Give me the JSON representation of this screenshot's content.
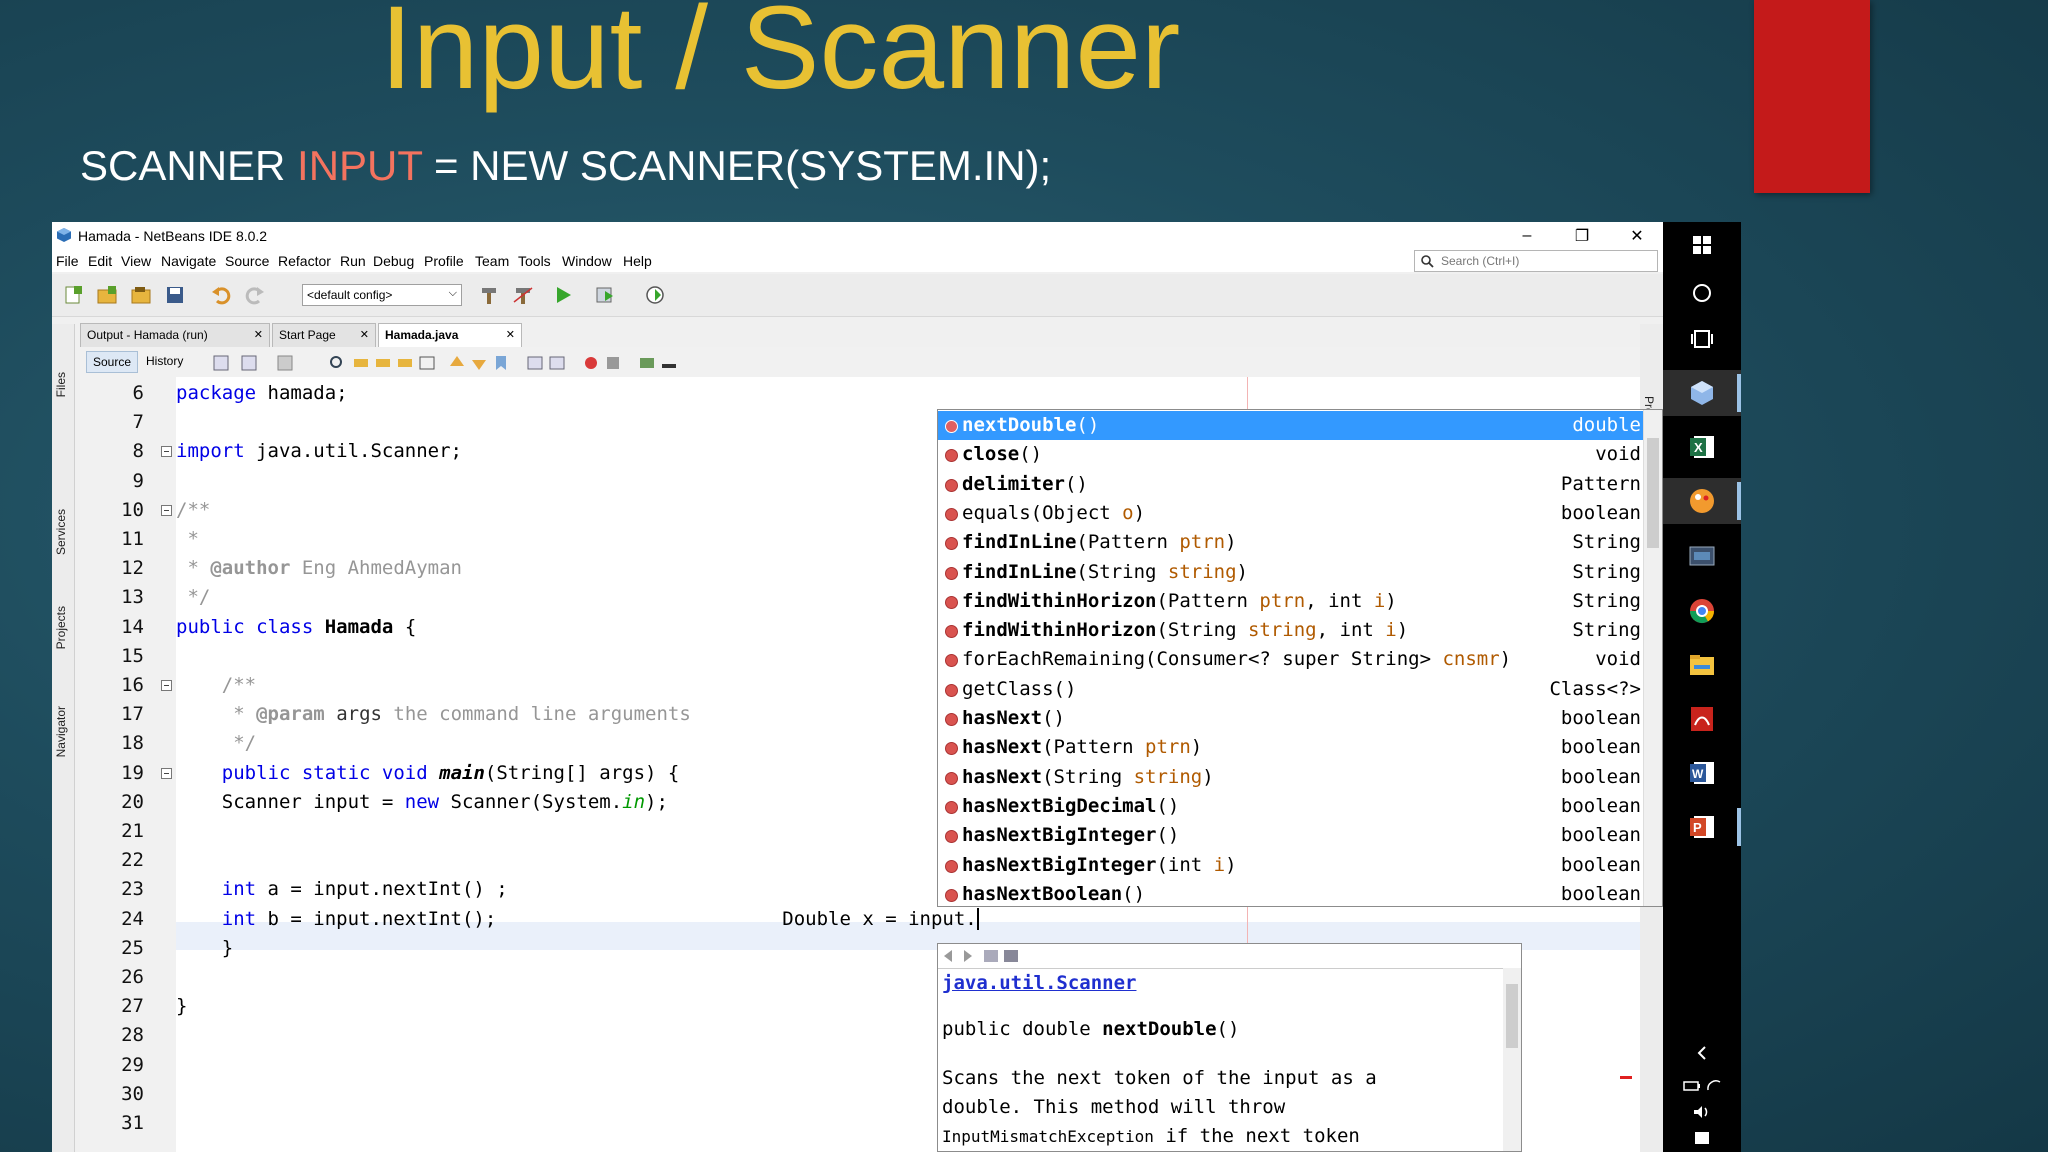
{
  "slide": {
    "title": "Input / Scanner",
    "subtitle_before": "SCANNER ",
    "subtitle_highlight": "INPUT",
    "subtitle_after": " = NEW SCANNER(SYSTEM.IN);",
    "title_color": "#e8c133",
    "highlight_color": "#f4735f",
    "accent_block_color": "#c41a1a"
  },
  "window": {
    "title": "Hamada - NetBeans IDE 8.0.2",
    "controls": {
      "minimize": "–",
      "restore": "❐",
      "close": "✕"
    }
  },
  "menubar": {
    "items": [
      "File",
      "Edit",
      "View",
      "Navigate",
      "Source",
      "Refactor",
      "Run",
      "Debug",
      "Profile",
      "Team",
      "Tools",
      "Window",
      "Help"
    ]
  },
  "search": {
    "placeholder": "Search (Ctrl+I)"
  },
  "toolbar": {
    "config_value": "<default config>"
  },
  "side_panels": [
    "Files",
    "Services",
    "Projects",
    "Navigator"
  ],
  "right_panel": "Prope",
  "tabs": [
    {
      "label": "Output - Hamada (run)"
    },
    {
      "label": "Start Page"
    },
    {
      "label": "Hamada.java",
      "active": true
    }
  ],
  "editor_toolbar": {
    "source_label": "Source",
    "history_label": "History"
  },
  "code": [
    {
      "line": "6",
      "html": "<span class='kw'>package</span> hamada;"
    },
    {
      "line": "7",
      "html": ""
    },
    {
      "line": "8",
      "html": "<span class='kw'>import</span> java.util.Scanner;",
      "fold": true
    },
    {
      "line": "9",
      "html": ""
    },
    {
      "line": "10",
      "html": "<span class='cm'>/**</span>",
      "fold": true
    },
    {
      "line": "11",
      "html": "<span class='cm'> *</span>"
    },
    {
      "line": "12",
      "html": "<span class='cm'> * <span class='tag'>@author</span> Eng AhmedAyman</span>"
    },
    {
      "line": "13",
      "html": "<span class='cm'> */</span>"
    },
    {
      "line": "14",
      "html": "<span class='kw'>public class</span> <span class='bold'>Hamada</span> {"
    },
    {
      "line": "15",
      "html": ""
    },
    {
      "line": "16",
      "html": "    <span class='cm'>/**</span>",
      "fold": true
    },
    {
      "line": "17",
      "html": "    <span class='cm'> * <span class='tag'>@param</span> <span style='color:#333'>args</span> the command line arguments</span>"
    },
    {
      "line": "18",
      "html": "    <span class='cm'> */</span>"
    },
    {
      "line": "19",
      "html": "    <span class='kw'>public static void</span> <span class='bold it'>main</span>(String[] args) {",
      "fold": true
    },
    {
      "line": "20",
      "html": "    Scanner input = <span class='kw'>new</span> Scanner(System.<span class='field'>in</span>);"
    },
    {
      "line": "21",
      "html": ""
    },
    {
      "line": "22",
      "html": ""
    },
    {
      "line": "23",
      "html": "    <span class='kw'>int</span> a = input.nextInt() ;"
    },
    {
      "line": "24",
      "html": "    <span class='kw'>int</span> b = input.nextInt();                         Double x = input.<span class='caret'></span>"
    },
    {
      "line": "25",
      "html": "    }"
    },
    {
      "line": "26",
      "html": ""
    },
    {
      "line": "27",
      "html": "}"
    },
    {
      "line": "28",
      "html": ""
    },
    {
      "line": "29",
      "html": ""
    },
    {
      "line": "30",
      "html": ""
    },
    {
      "line": "31",
      "html": ""
    }
  ],
  "completion": [
    {
      "name": "nextDouble",
      "params": "()",
      "type": "double",
      "bold": true,
      "selected": true
    },
    {
      "name": "close",
      "params": "()",
      "type": "void",
      "bold": true
    },
    {
      "name": "delimiter",
      "params": "()",
      "type": "Pattern",
      "bold": true
    },
    {
      "name": "equals",
      "params": "(Object <span class='pa'>o</span>)",
      "type": "boolean",
      "bold": false
    },
    {
      "name": "findInLine",
      "params": "(Pattern <span class='pa'>ptrn</span>)",
      "type": "String",
      "bold": true
    },
    {
      "name": "findInLine",
      "params": "(String <span class='pa'>string</span>)",
      "type": "String",
      "bold": true
    },
    {
      "name": "findWithinHorizon",
      "params": "(Pattern <span class='pa'>ptrn</span>, int <span class='pa'>i</span>)",
      "type": "String",
      "bold": true
    },
    {
      "name": "findWithinHorizon",
      "params": "(String <span class='pa'>string</span>, int <span class='pa'>i</span>)",
      "type": "String",
      "bold": true
    },
    {
      "name": "forEachRemaining",
      "params": "(Consumer&lt;? super String&gt; <span class='pa'>cnsmr</span>)",
      "type": "void",
      "bold": false
    },
    {
      "name": "getClass",
      "params": "()",
      "type": "Class<?>",
      "bold": false
    },
    {
      "name": "hasNext",
      "params": "()",
      "type": "boolean",
      "bold": true
    },
    {
      "name": "hasNext",
      "params": "(Pattern <span class='pa'>ptrn</span>)",
      "type": "boolean",
      "bold": true
    },
    {
      "name": "hasNext",
      "params": "(String <span class='pa'>string</span>)",
      "type": "boolean",
      "bold": true
    },
    {
      "name": "hasNextBigDecimal",
      "params": "()",
      "type": "boolean",
      "bold": true
    },
    {
      "name": "hasNextBigInteger",
      "params": "()",
      "type": "boolean",
      "bold": true
    },
    {
      "name": "hasNextBigInteger",
      "params": "(int <span class='pa'>i</span>)",
      "type": "boolean",
      "bold": true
    },
    {
      "name": "hasNextBoolean",
      "params": "()",
      "type": "boolean",
      "bold": true
    }
  ],
  "doc": {
    "class_link": "java.util.Scanner",
    "signature_prefix": "public double ",
    "signature_name": "nextDouble",
    "signature_suffix": "()",
    "desc_line1": "Scans the next token of the input as a",
    "desc_line2": "double. This method will throw",
    "desc_line3_exc": "InputMismatchException",
    "desc_line3_rest": " if the next token"
  },
  "taskbar": {
    "icons": [
      "windows-start-icon",
      "cortana-search-icon",
      "task-view-icon",
      "virtualbox-icon",
      "excel-icon",
      "paint-app-icon",
      "screen-app-icon",
      "chrome-icon",
      "file-explorer-icon",
      "acrobat-icon",
      "word-icon",
      "powerpoint-icon"
    ],
    "tray": [
      "chevron-left-icon",
      "battery-icon",
      "wifi-icon",
      "volume-icon",
      "notification-icon"
    ]
  }
}
